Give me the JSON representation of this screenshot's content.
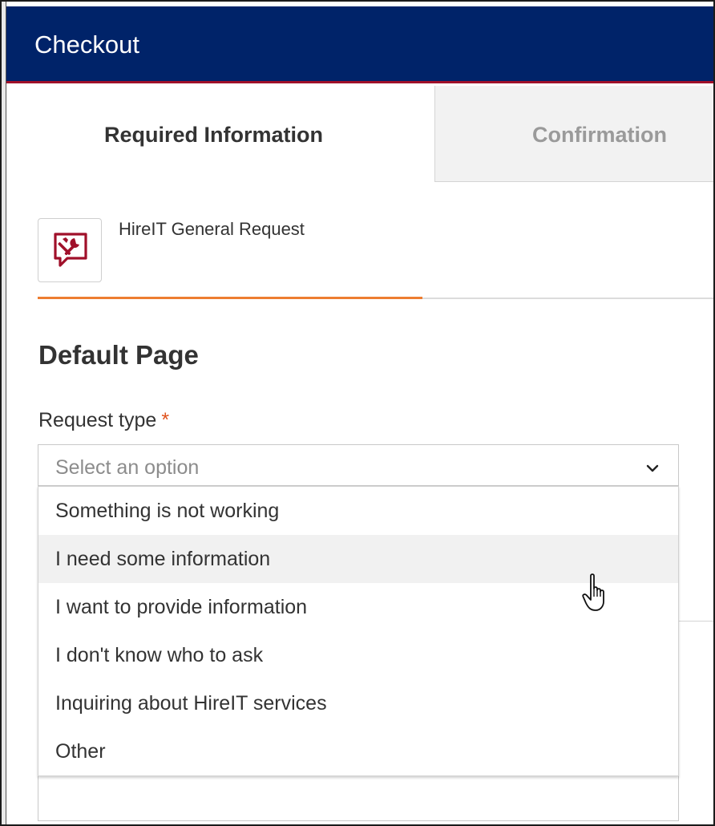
{
  "dialog": {
    "title": "Checkout"
  },
  "tabs": [
    {
      "label": "Required Information",
      "active": true
    },
    {
      "label": "Confirmation",
      "active": false
    }
  ],
  "item": {
    "name": "HireIT General Request",
    "icon": "chat-tools-icon",
    "icon_color": "#a0102a"
  },
  "progress": {
    "fraction": 0.5,
    "color": "#ed7d31"
  },
  "page": {
    "heading": "Default Page"
  },
  "form": {
    "request_type": {
      "label": "Request type",
      "required_marker": "*",
      "placeholder": "Select an option",
      "options": [
        "Something is not working",
        "I need some information",
        "I want to provide information",
        "I don't know who to ask",
        "Inquiring about HireIT services",
        "Other"
      ],
      "hovered_option": "I need some information"
    }
  },
  "colors": {
    "header_bg": "#002369",
    "header_accent": "#a0102a",
    "required_star": "#e0531e"
  }
}
